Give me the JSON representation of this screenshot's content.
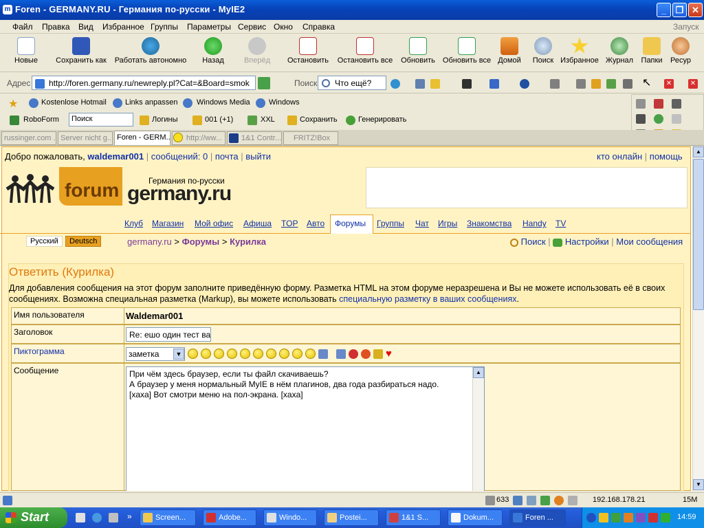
{
  "window": {
    "title": "Foren - GERMANY.RU - Германия по-русски - MyIE2",
    "app_icon": "myie2-icon"
  },
  "menu": {
    "items": [
      "Файл",
      "Правка",
      "Вид",
      "Избранное",
      "Группы",
      "Параметры",
      "Сервис",
      "Окно",
      "Справка"
    ],
    "right": "Запуск"
  },
  "toolbar": {
    "new": "Новые",
    "save_as": "Сохранить как",
    "offline": "Работать автономно",
    "back": "Назад",
    "forward": "Вперёд",
    "stop": "Остановить",
    "stop_all": "Остановить все",
    "refresh": "Обновить",
    "refresh_all": "Обновить все",
    "home": "Домой",
    "search": "Поиск",
    "favorites": "Избранное",
    "history": "Журнал",
    "folders": "Папки",
    "resources": "Ресур"
  },
  "address": {
    "label": "Адрес",
    "url": "http://foren.germany.ru/newreply.pl?Cat=&Board=smok",
    "search_label": "Поиск",
    "search_value": "Что ещё?"
  },
  "links": {
    "items": [
      "Kostenlose Hotmail",
      "Links anpassen",
      "Windows Media",
      "Windows"
    ]
  },
  "roboform": {
    "label": "RoboForm",
    "search_value": "Поиск",
    "logins": "Логины",
    "count": "001 (+1)",
    "xxl": "XXL",
    "save": "Сохранить",
    "generate": "Генерировать"
  },
  "tabs": [
    {
      "label": "russinger.com ..."
    },
    {
      "label": "Server nicht g..."
    },
    {
      "label": "Foren - GERM..."
    },
    {
      "label": "http://ww..."
    },
    {
      "label": "1&1 Contr..."
    },
    {
      "label": "FRITZ!Box"
    }
  ],
  "page": {
    "welcome": "Добро пожаловать,",
    "username": "waldemar001",
    "messages": "сообщений: 0",
    "mail": "почта",
    "logout": "выйти",
    "who_online": "кто онлайн",
    "help": "помощь",
    "logo_forum": "forum",
    "logo_tagline": "Германия по-русски",
    "logo_site": "germany.ru",
    "nav": [
      "Клуб",
      "Магазин",
      "Мой офис",
      "Афиша",
      "TOP",
      "Авто",
      "Форумы",
      "Группы",
      "Чат",
      "Игры",
      "Знакомства",
      "Handy",
      "TV"
    ],
    "lang_ru": "Русский",
    "lang_de": "Deutsch",
    "crumb_site": "germany.ru",
    "crumb_sep": ">",
    "crumb_forums": "Форумы",
    "crumb_board": "Курилка",
    "search": "Поиск",
    "settings": "Настройки",
    "my_messages": "Мои сообщения",
    "reply_title": "Ответить (Курилка)",
    "info_text": "Для добавления сообщения на этот форум заполните приведённую форму. Разметка HTML на этом форуме неразрешена и Вы не можете использовать её в своих сообщениях. Возможна специальная разметка (Markup), вы можете использовать",
    "info_link": "специальную разметку в ваших сообщениях",
    "info_end": ".",
    "form": {
      "user_label": "Имя пользователя",
      "user_value": "Waldemar001",
      "subject_label": "Заголовок",
      "subject_value": "Re: ешо один тест ва",
      "icon_label": "Пиктограмма",
      "icon_select": "заметка",
      "message_label": "Сообщение",
      "message_lines": [
        "При чём здесь браузер, если ты файл скачиваешь?",
        "А браузер у меня нормальный MyIE в нём плагинов, два года разбираться надо.",
        "[xaxa] Вот смотри меню на пол-экрана. [xaxa]"
      ]
    }
  },
  "status": {
    "count": "633",
    "ip": "192.168.178.21",
    "mem": "15M"
  },
  "taskbar": {
    "start": "Start",
    "tasks": [
      "Screen...",
      "Adobe...",
      "Windo...",
      "Postei...",
      "1&1 S...",
      "Dokum...",
      "Foren ..."
    ],
    "clock": "14:59"
  },
  "colors": {
    "brand_orange": "#e8a020",
    "forum_bg": "#fff3c4",
    "link": "#1030a8",
    "title_orange": "#e07a10"
  }
}
